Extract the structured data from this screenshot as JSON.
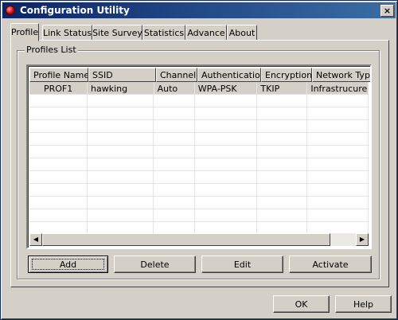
{
  "window": {
    "title": "Configuration Utility",
    "close_glyph": "×"
  },
  "tabs": [
    {
      "label": "Profile",
      "active": true
    },
    {
      "label": "Link Status",
      "active": false
    },
    {
      "label": "Site Survey",
      "active": false
    },
    {
      "label": "Statistics",
      "active": false
    },
    {
      "label": "Advance",
      "active": false
    },
    {
      "label": "About",
      "active": false
    }
  ],
  "profiles": {
    "group_label": "Profiles List",
    "columns": [
      "Profile Name",
      "SSID",
      "Channel",
      "Authentication",
      "Encryption",
      "Network Type"
    ],
    "rows": [
      [
        "PROF1",
        "hawking",
        "Auto",
        "WPA-PSK",
        "TKIP",
        "Infrastrucure"
      ]
    ],
    "scroll_left_glyph": "◀",
    "scroll_right_glyph": "▶"
  },
  "actions": {
    "add": "Add",
    "delete": "Delete",
    "edit": "Edit",
    "activate": "Activate"
  },
  "footer": {
    "ok": "OK",
    "help": "Help"
  },
  "colors": {
    "titlebar_start": "#0a246a",
    "titlebar_end": "#3a6ea5",
    "face": "#d4d0c8",
    "selected_row": "#d4d0c8"
  }
}
